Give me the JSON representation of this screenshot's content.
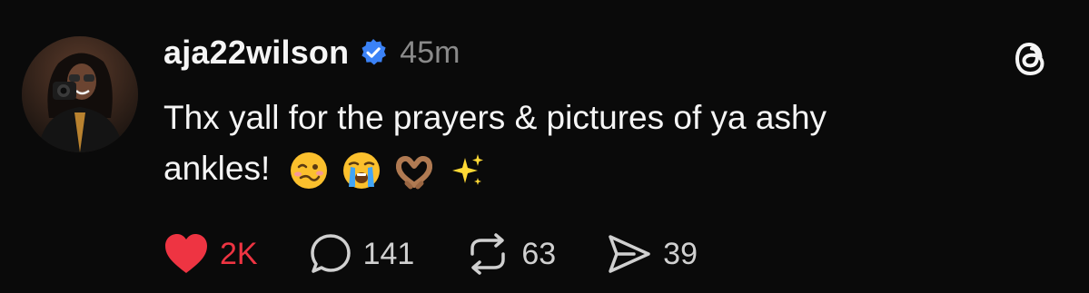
{
  "post": {
    "username": "aja22wilson",
    "timestamp": "45m",
    "text_line1": "Thx yall for the prayers & pictures of ya ashy",
    "text_line2": "ankles!",
    "emojis": [
      "woozy-face",
      "loudly-crying-face",
      "heart-hands",
      "sparkles"
    ],
    "verified_color": "#3b82f6",
    "brand_icon": "threads-logo-icon"
  },
  "actions": {
    "like_count": "2K",
    "reply_count": "141",
    "repost_count": "63",
    "share_count": "39",
    "like_color": "#ee3442"
  }
}
